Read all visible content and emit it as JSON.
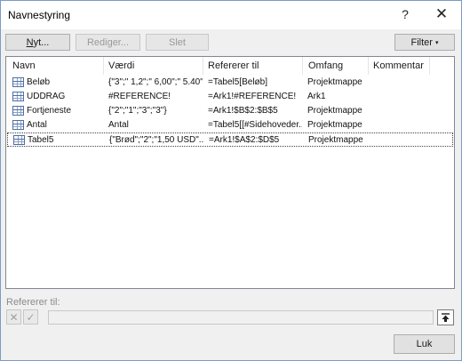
{
  "dialog": {
    "title": "Navnestyring",
    "help_glyph": "?",
    "close_glyph": "✕"
  },
  "toolbar": {
    "new_u": "N",
    "new_rest": "yt...",
    "edit_label": "Rediger...",
    "delete_label": "Slet",
    "filter_label": "Filter",
    "filter_caret": "▾"
  },
  "columns": [
    "Navn",
    "Værdi",
    "Refererer til",
    "Omfang",
    "Kommentar"
  ],
  "rows": [
    {
      "icon": "table-icon",
      "name": "Beløb",
      "value": "{\"3\";\" 1,2\";\" 6,00\";\" 5.40\"}",
      "refers_to": "=Tabel5[Beløb]",
      "scope": "Projektmappe",
      "comment": ""
    },
    {
      "icon": "table-icon",
      "name": "UDDRAG",
      "value": "#REFERENCE!",
      "refers_to": "=Ark1!#REFERENCE!",
      "scope": "Ark1",
      "comment": ""
    },
    {
      "icon": "table-icon",
      "name": "Fortjeneste",
      "value": "{\"2\";\"1\";\"3\";\"3\"}",
      "refers_to": "=Ark1!$B$2:$B$5",
      "scope": "Projektmappe",
      "comment": ""
    },
    {
      "icon": "table-icon",
      "name": "Antal",
      "value": "Antal",
      "refers_to": "=Tabel5[[#Sidehoveder...",
      "scope": "Projektmappe",
      "comment": ""
    },
    {
      "icon": "table-icon",
      "name": "Tabel5",
      "value": "{\"Brød\";\"2\";\"1,50 USD\"...",
      "refers_to": "=Ark1!$A$2:$D$5",
      "scope": "Projektmappe",
      "comment": "",
      "selected": true
    }
  ],
  "refers_to_section": {
    "label": "Refererer til:",
    "value": "",
    "cancel_glyph": "✕",
    "ok_glyph": "✓"
  },
  "footer": {
    "close_label": "Luk"
  }
}
